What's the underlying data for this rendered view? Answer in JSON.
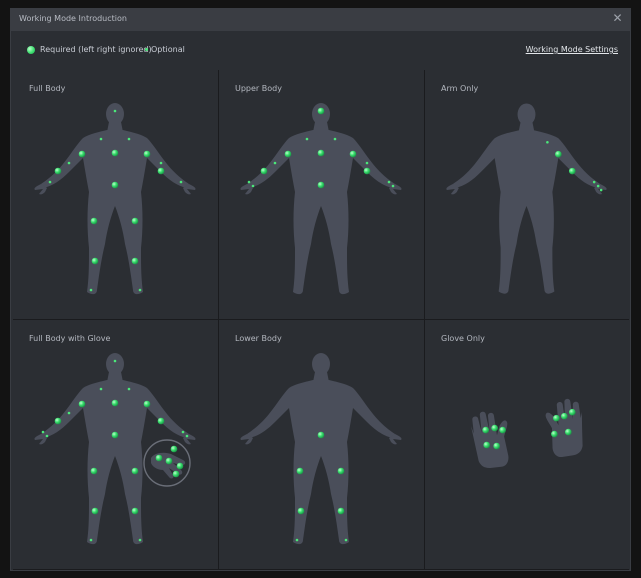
{
  "window": {
    "title": "Working Mode Introduction",
    "close_icon": "close-icon"
  },
  "legend": {
    "required_label": "Required (left right ignored)",
    "optional_label": "Optional",
    "settings_link": "Working Mode Settings"
  },
  "colors": {
    "background": "#2b2e33",
    "silhouette": "#4a4e5a",
    "sensor": "#3de070"
  },
  "modes": [
    {
      "label": "Full Body"
    },
    {
      "label": "Upper Body"
    },
    {
      "label": "Arm Only"
    },
    {
      "label": "Full Body with Glove"
    },
    {
      "label": "Lower Body"
    },
    {
      "label": "Glove Only"
    }
  ]
}
